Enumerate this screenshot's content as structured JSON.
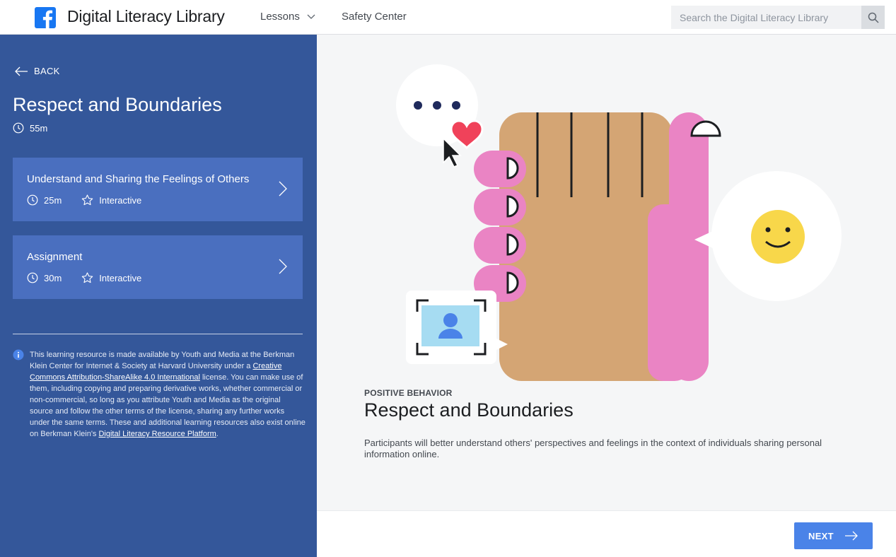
{
  "header": {
    "site_title": "Digital Literacy Library",
    "nav": {
      "lessons": "Lessons",
      "safety": "Safety Center"
    },
    "search": {
      "placeholder": "Search the Digital Literacy Library"
    },
    "logo_icon": "facebook-logo-icon",
    "brand_color": "#1877f2"
  },
  "sidebar": {
    "back_label": "BACK",
    "title": "Respect and Boundaries",
    "duration": "55m",
    "cards": [
      {
        "title": "Understand and Sharing the Feelings of Others",
        "duration": "25m",
        "type": "Interactive"
      },
      {
        "title": "Assignment",
        "duration": "30m",
        "type": "Interactive"
      }
    ],
    "license": {
      "text_1": "This learning resource is made available by Youth and Media at the Berkman Klein Center for Internet & Society at Harvard University under a ",
      "link_1": "Creative Commons Attribution-ShareAlike 4.0 International",
      "text_2": " license. You can make use of them, including copying and preparing derivative works, whether commercial or non-commercial, so long as you attribute Youth and Media as the original source and follow the other terms of the license, sharing any further works under the same terms. These and additional learning resources also exist online on Berkman Klein's ",
      "link_2": "Digital Literacy Resource Platform",
      "text_3": "."
    },
    "bg_color": "#34579a",
    "card_color": "#4a6fbf"
  },
  "main": {
    "kicker": "POSITIVE BEHAVIOR",
    "title": "Respect and Boundaries",
    "description": "Participants will better understand others' perspectives and feelings in the context of individuals sharing personal information online."
  },
  "footer": {
    "next_label": "NEXT",
    "button_color": "#4a83e8"
  }
}
